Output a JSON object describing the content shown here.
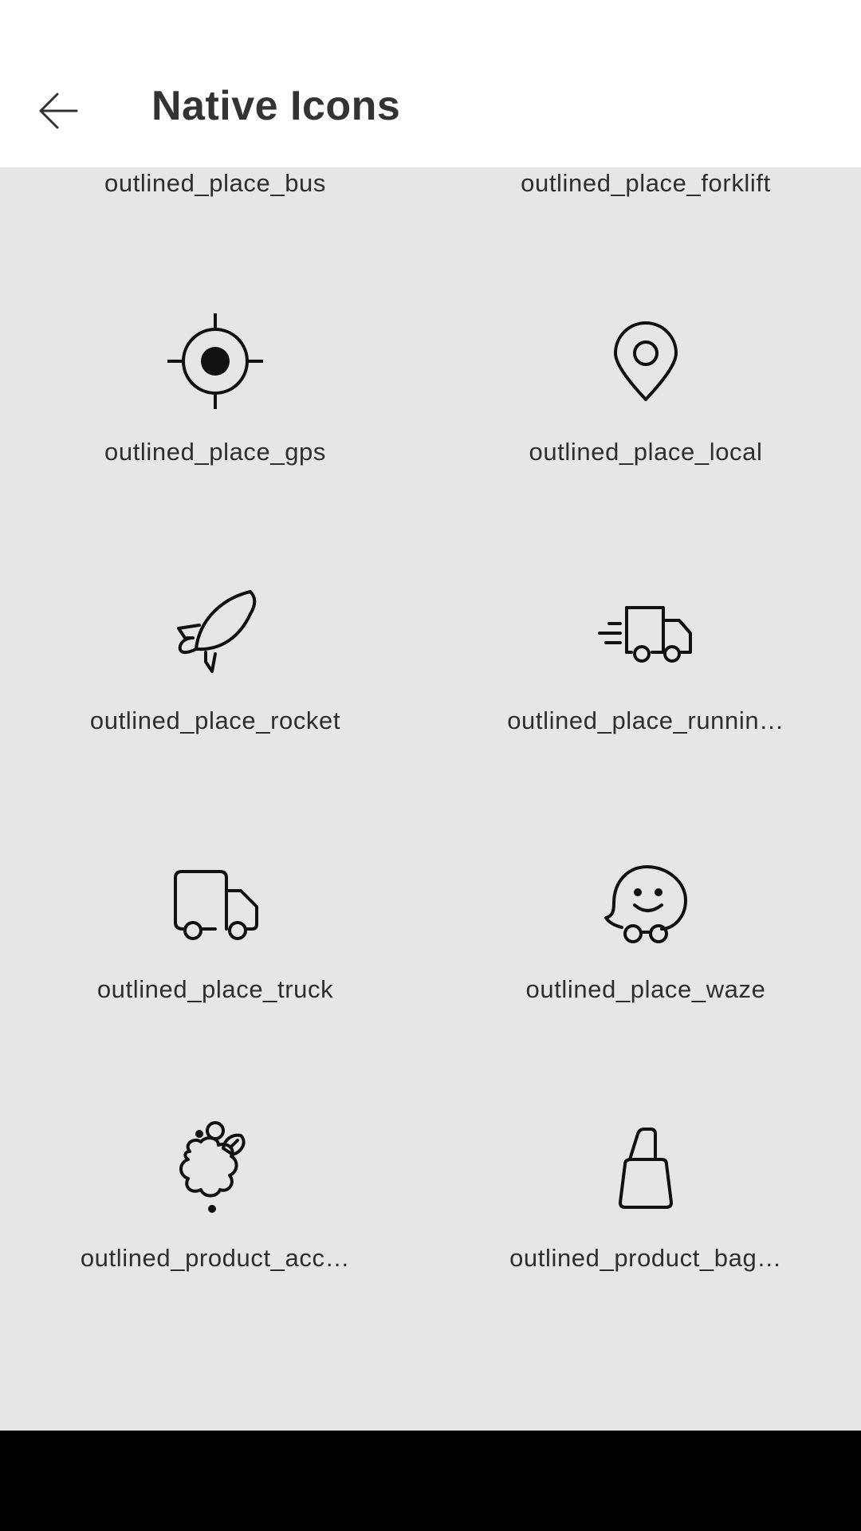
{
  "header": {
    "title": "Native Icons",
    "back_icon": "arrow-back-icon"
  },
  "icons": [
    {
      "label": "outlined_place_bus",
      "icon": "bus-icon"
    },
    {
      "label": "outlined_place_forklift",
      "icon": "forklift-icon"
    },
    {
      "label": "outlined_place_gps",
      "icon": "gps-icon"
    },
    {
      "label": "outlined_place_local",
      "icon": "location-pin-icon"
    },
    {
      "label": "outlined_place_rocket",
      "icon": "rocket-icon"
    },
    {
      "label": "outlined_place_runnin…",
      "icon": "fast-delivery-truck-icon"
    },
    {
      "label": "outlined_place_truck",
      "icon": "truck-icon"
    },
    {
      "label": "outlined_place_waze",
      "icon": "waze-icon"
    },
    {
      "label": "outlined_product_acc…",
      "icon": "accessories-icon"
    },
    {
      "label": "outlined_product_bag…",
      "icon": "shopping-bag-icon"
    }
  ]
}
